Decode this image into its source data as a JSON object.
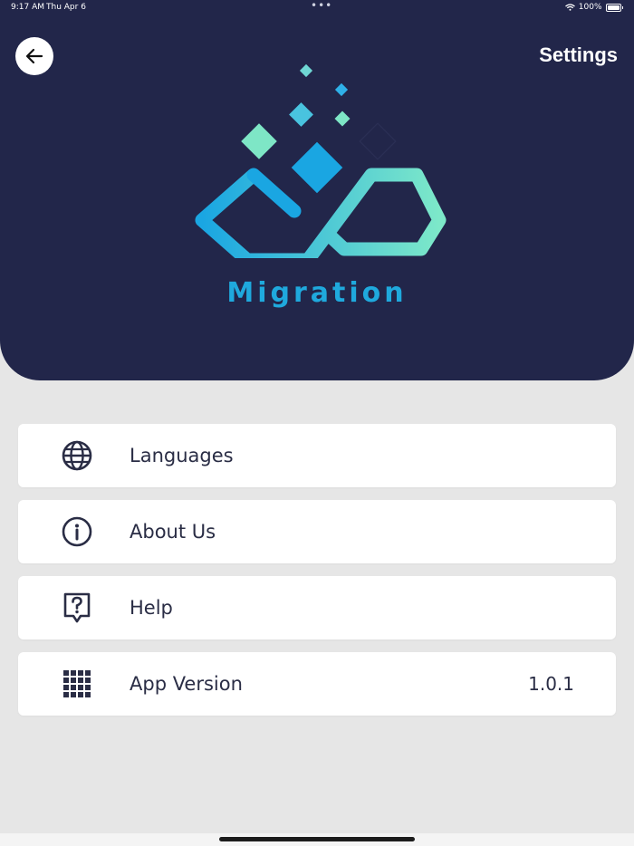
{
  "status_bar": {
    "time": "9:17 AM",
    "date": "Thu Apr 6",
    "battery": "100%",
    "icons": [
      "wifi-icon",
      "battery-icon"
    ]
  },
  "header": {
    "back_icon": "arrow-left-icon",
    "title": "Settings",
    "logo_text": "Migration",
    "colors": {
      "background": "#22264a",
      "logo_blue": "#1fa9dd",
      "logo_aqua": "#7ee6c6"
    }
  },
  "menu": {
    "items": [
      {
        "label": "Languages",
        "icon": "globe-icon"
      },
      {
        "label": "About Us",
        "icon": "info-icon"
      },
      {
        "label": "Help",
        "icon": "help-icon"
      },
      {
        "label": "App Version",
        "icon": "grid-icon",
        "value": "1.0.1"
      }
    ]
  }
}
